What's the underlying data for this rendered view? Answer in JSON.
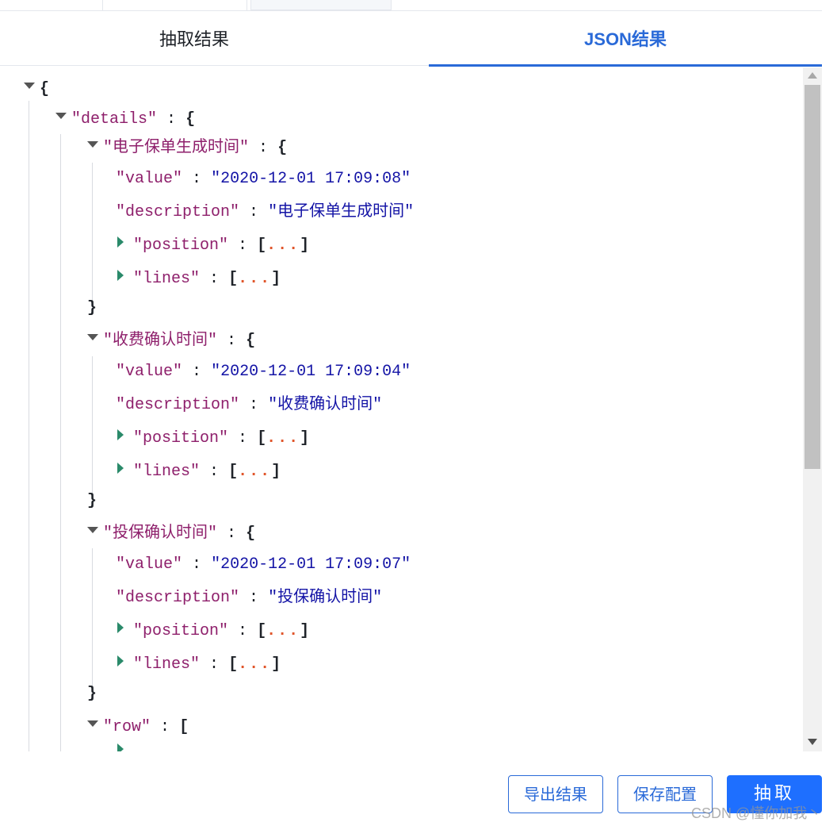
{
  "tabs": [
    {
      "label": "抽取结果",
      "active": false
    },
    {
      "label": "JSON结果",
      "active": true
    }
  ],
  "json": {
    "open_brace": "{",
    "close_brace": "}",
    "open_bracket": "[",
    "close_bracket": "]",
    "colon": ":",
    "collapsed": "...",
    "details_key": "\"details\"",
    "row_key": "\"row\"",
    "items": [
      {
        "key": "\"电子保单生成时间\"",
        "value": "\"2020-12-01 17:09:08\"",
        "description": "\"电子保单生成时间\""
      },
      {
        "key": "\"收费确认时间\"",
        "value": "\"2020-12-01 17:09:04\"",
        "description": "\"收费确认时间\""
      },
      {
        "key": "\"投保确认时间\"",
        "value": "\"2020-12-01 17:09:07\"",
        "description": "\"投保确认时间\""
      }
    ],
    "fields": {
      "value": "\"value\"",
      "description": "\"description\"",
      "position": "\"position\"",
      "lines": "\"lines\""
    }
  },
  "buttons": {
    "export": "导出结果",
    "save": "保存配置",
    "extract": "抽取"
  },
  "watermark": "CSDN @懂你加我丶",
  "colors": {
    "accent": "#2a6ad8",
    "primary_button": "#1e6fff",
    "json_key": "#8e1f6b",
    "json_string": "#1414a6",
    "collapsed_dots": "#e0552a"
  }
}
